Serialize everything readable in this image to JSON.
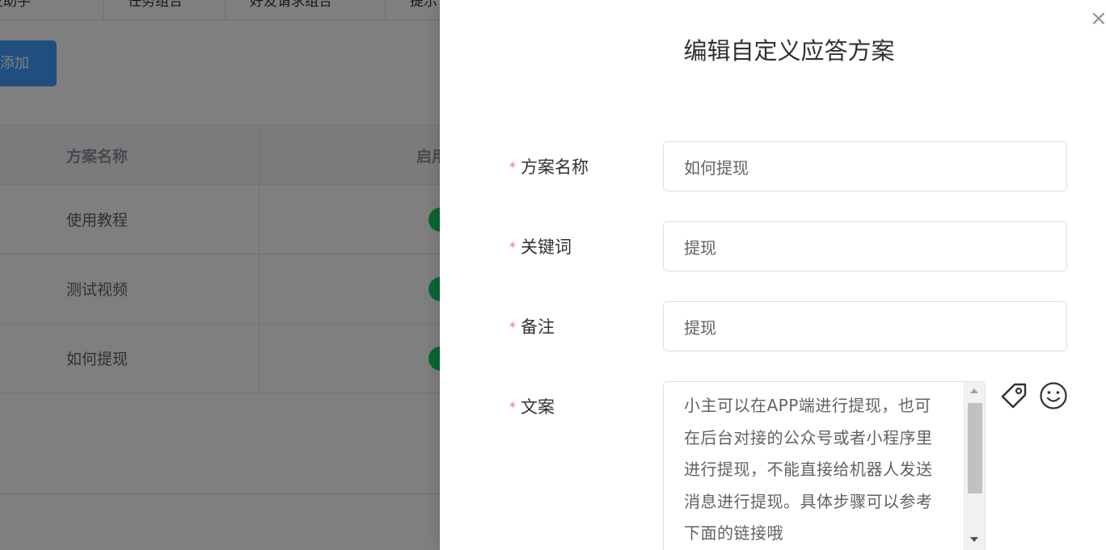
{
  "background": {
    "tabs": [
      "群发助手",
      "任务组合",
      "好友请求组合",
      "提示"
    ],
    "add_button": "添加",
    "table": {
      "headers": [
        "方案名称",
        "启用"
      ],
      "rows": [
        {
          "name": "使用教程"
        },
        {
          "name": "测试视频"
        },
        {
          "name": "如何提现"
        }
      ]
    }
  },
  "drawer": {
    "title": "编辑自定义应答方案",
    "close_symbol": "×",
    "required_mark": "*",
    "fields": {
      "name": {
        "label": "方案名称",
        "value": "如何提现"
      },
      "keyword": {
        "label": "关键词",
        "value": "提现"
      },
      "remark": {
        "label": "备注",
        "value": "提现"
      },
      "content": {
        "label": "文案",
        "value": "小主可以在APP端进行提现，也可在后台对接的公众号或者小程序里进行提现，不能直接给机器人发送消息进行提现。具体步骤可以参考下面的链接哦"
      }
    },
    "tools": {
      "tag_icon": "tag-icon",
      "emoji_icon": "smiley-icon"
    }
  },
  "colors": {
    "primary": "#409eff",
    "required": "#f56c6c",
    "switch_on": "#13ce66"
  }
}
